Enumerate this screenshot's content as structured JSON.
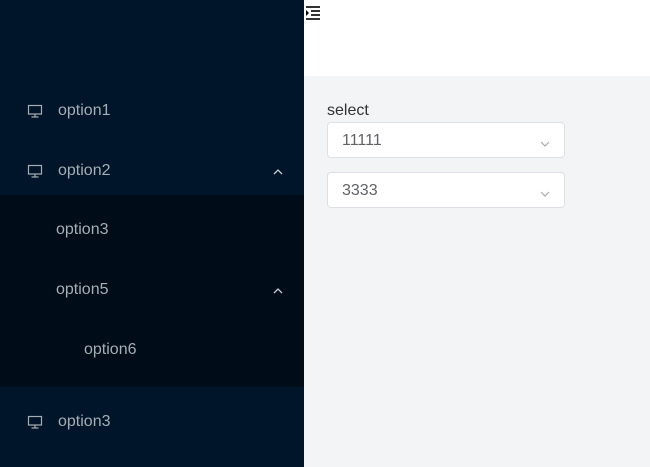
{
  "sidebar": {
    "items": [
      {
        "label": "option1",
        "icon": "monitor-icon"
      },
      {
        "label": "option2",
        "icon": "monitor-icon",
        "expanded": true
      },
      {
        "label": "option3",
        "icon": "monitor-icon"
      }
    ],
    "submenu": {
      "items": [
        {
          "label": "option3"
        },
        {
          "label": "option5",
          "expanded": true
        },
        {
          "label": "option6"
        }
      ]
    },
    "colors": {
      "background": "#001529",
      "submenu_background": "#000c17",
      "text": "#a6adb4"
    }
  },
  "header": {
    "toggle_icon": "menu-fold-icon"
  },
  "form": {
    "label": "select",
    "selects": [
      {
        "value": "11111"
      },
      {
        "value": "3333"
      }
    ]
  }
}
